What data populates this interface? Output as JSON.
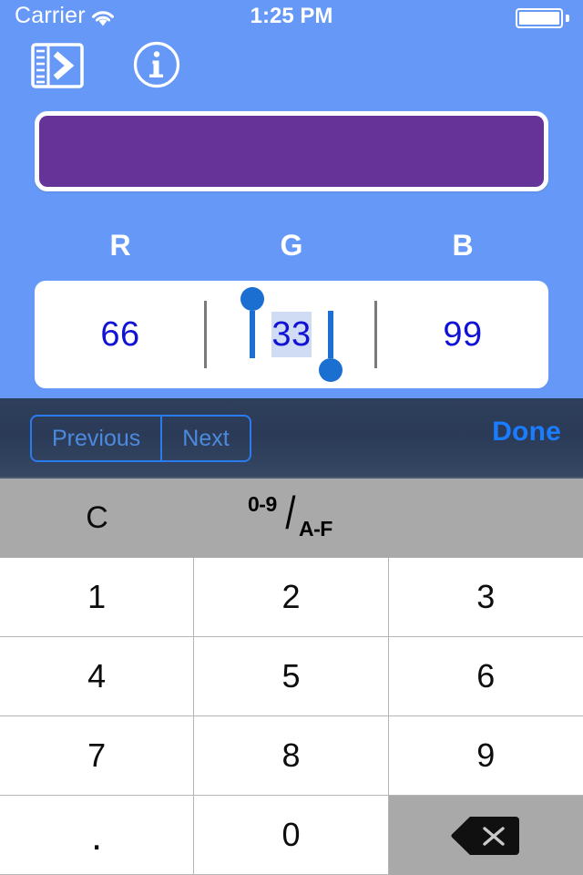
{
  "status_bar": {
    "carrier": "Carrier",
    "wifi_icon": "wifi-icon",
    "time": "1:25 PM",
    "battery_icon": "battery-full-icon"
  },
  "nav_bar": {
    "drawer_icon": "list-drawer-chevron-icon",
    "info_icon": "info-circle-icon"
  },
  "color_preview": {
    "hex": "#663399",
    "name": "color-swatch"
  },
  "channels": {
    "labels": [
      "R",
      "G",
      "B"
    ],
    "values": [
      "66",
      "33",
      "99"
    ],
    "active_index": 1,
    "text_color": "#1212d6",
    "selection_color": "#cfdcf3",
    "handle_color": "#1a6fd0"
  },
  "accessory_bar": {
    "previous_label": "Previous",
    "next_label": "Next",
    "done_label": "Done",
    "accent_color": "#1a7cff",
    "background_color": "#2e3f5c"
  },
  "keyboard": {
    "clear_label": "C",
    "mode_toggle": {
      "numerator": "0-9",
      "separator": "/",
      "denominator": "A-F"
    },
    "keys": [
      "1",
      "2",
      "3",
      "4",
      "5",
      "6",
      "7",
      "8",
      "9",
      ".",
      "0",
      ""
    ],
    "backspace_icon": "backspace-delete-icon",
    "background_color": "#a9a9a9"
  }
}
